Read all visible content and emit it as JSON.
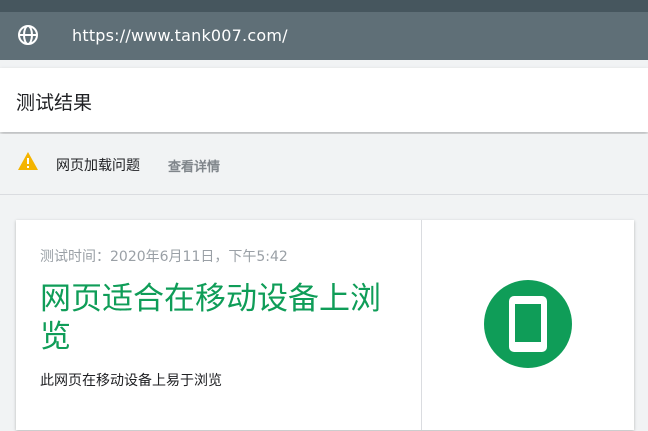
{
  "browser": {
    "url": "https://www.tank007.com/",
    "globe_icon": "globe-icon"
  },
  "header": {
    "title": "测试结果"
  },
  "issue": {
    "icon": "warning-icon",
    "icon_color": "#f4b400",
    "text": "网页加载问题",
    "link": "查看详情"
  },
  "result_card": {
    "test_time": "测试时间：2020年6月11日，下午5:42",
    "title": "网页适合在移动设备上浏览",
    "description": "此网页在移动设备上易于浏览",
    "badge_icon": "mobile-phone-icon",
    "accent_color": "#0f9d58"
  }
}
